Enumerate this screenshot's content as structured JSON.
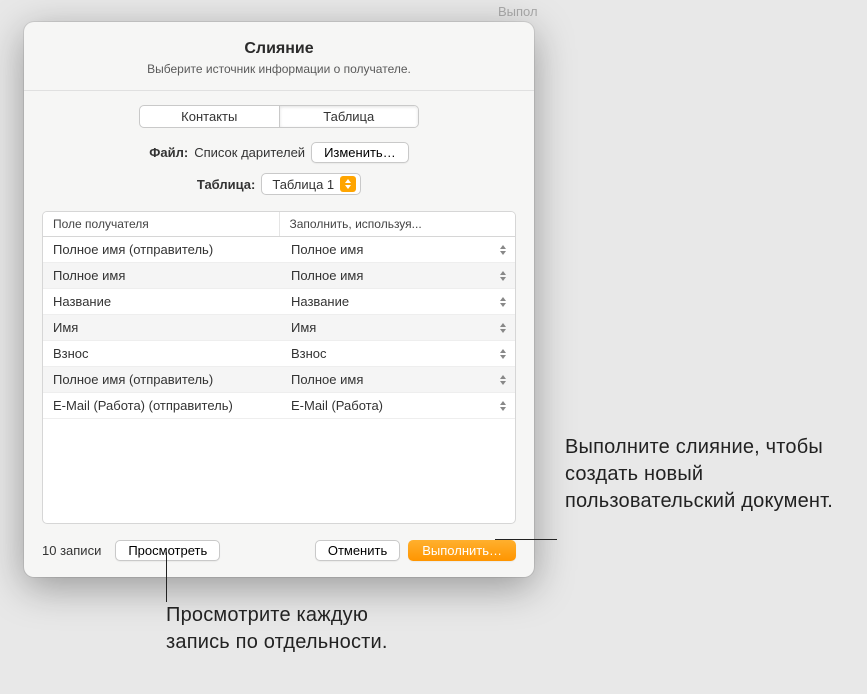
{
  "dialog": {
    "title": "Слияние",
    "subtitle": "Выберите источник информации о получателе.",
    "segment": {
      "contacts": "Контакты",
      "table": "Таблица"
    },
    "file_row": {
      "label": "Файл:",
      "value": "Список дарителей",
      "change_button": "Изменить…"
    },
    "table_row": {
      "label": "Таблица:",
      "value": "Таблица 1"
    },
    "columns": {
      "recipient_field": "Поле получателя",
      "fill_using": "Заполнить, используя..."
    },
    "rows": [
      {
        "recipient": "Полное имя (отправитель)",
        "fill": "Полное имя"
      },
      {
        "recipient": "Полное имя",
        "fill": "Полное имя"
      },
      {
        "recipient": "Название",
        "fill": "Название"
      },
      {
        "recipient": "Имя",
        "fill": "Имя"
      },
      {
        "recipient": "Взнос",
        "fill": "Взнос"
      },
      {
        "recipient": "Полное имя (отправитель)",
        "fill": "Полное имя"
      },
      {
        "recipient": "E-Mail (Работа) (отправитель)",
        "fill": "E-Mail (Работа)"
      }
    ],
    "footer": {
      "records": "10 записи",
      "preview": "Просмотреть",
      "cancel": "Отменить",
      "merge": "Выполнить…"
    }
  },
  "callouts": {
    "right": "Выполните слияние, чтобы создать новый пользовательский документ.",
    "bottom": "Просмотрите каждую запись по отдельности."
  },
  "bg": {
    "sidebar_label_1": "Выпол"
  }
}
